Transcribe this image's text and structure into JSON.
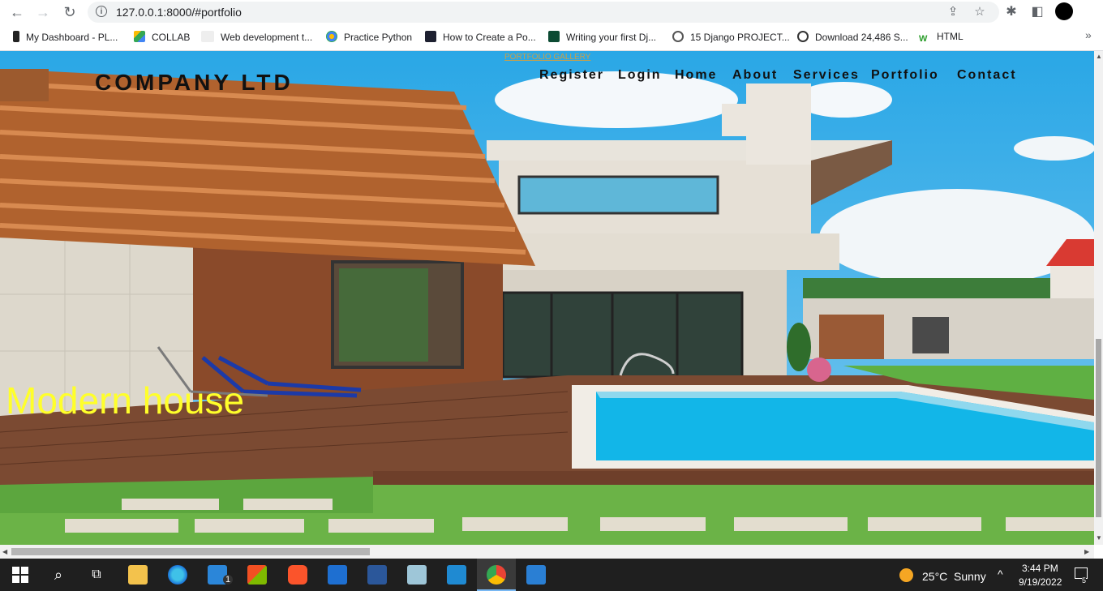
{
  "browser": {
    "url": "127.0.0.1:8000/#portfolio",
    "bookmarks": [
      "My Dashboard - PL...",
      "COLLAB",
      "Web development t...",
      "Practice Python",
      "How to Create a Po...",
      "Writing your first Dj...",
      "15 Django PROJECT...",
      "Download 24,486 S...",
      "HTML"
    ]
  },
  "page": {
    "top_link": "PORTFOLIO GALLERY",
    "company": "COMPANY LTD",
    "nav": [
      "Register",
      "Login",
      "Home",
      "About",
      "Services",
      "Portfolio",
      "Contact"
    ],
    "hero_title": "Modern house",
    "colors": {
      "hero_title": "#ffff2a",
      "link": "#c8a04a"
    }
  },
  "taskbar": {
    "mail_badge": "1",
    "weather_temp": "25°C",
    "weather_text": "Sunny",
    "time": "3:44 PM",
    "date": "9/19/2022",
    "notification_count": "5"
  }
}
